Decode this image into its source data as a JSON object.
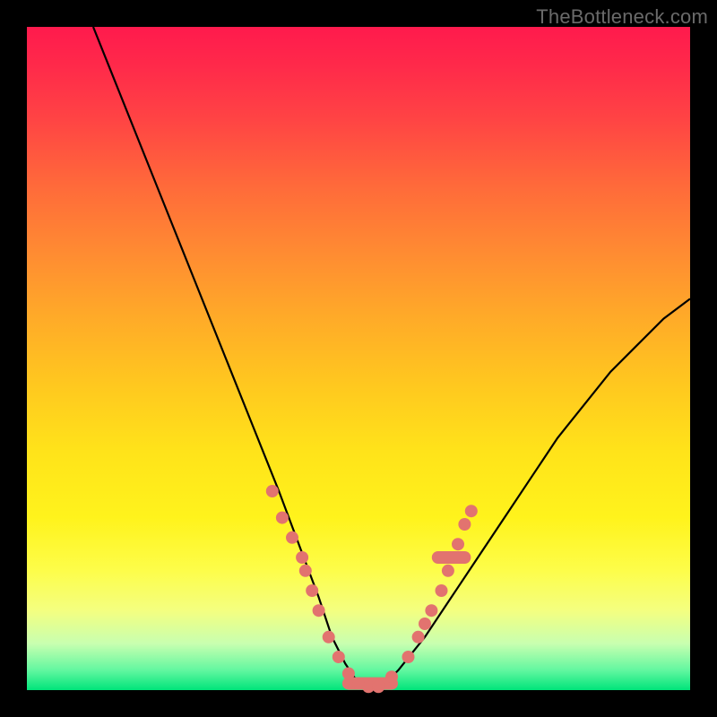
{
  "watermark": "TheBottleneck.com",
  "colors": {
    "frame": "#000000",
    "curve": "#000000",
    "marker": "#e2736f",
    "gradient_top": "#ff1a4d",
    "gradient_bottom": "#00e47a"
  },
  "chart_data": {
    "type": "line",
    "title": "",
    "xlabel": "",
    "ylabel": "",
    "xlim": [
      0,
      100
    ],
    "ylim": [
      0,
      100
    ],
    "series": [
      {
        "name": "bottleneck-curve",
        "x": [
          10,
          14,
          18,
          22,
          26,
          30,
          34,
          38,
          41,
          44,
          46,
          48,
          50,
          52,
          54,
          56,
          60,
          64,
          68,
          72,
          76,
          80,
          84,
          88,
          92,
          96,
          100
        ],
        "y": [
          100,
          90,
          80,
          70,
          60,
          50,
          40,
          30,
          22,
          14,
          8,
          4,
          1,
          0,
          1,
          3,
          8,
          14,
          20,
          26,
          32,
          38,
          43,
          48,
          52,
          56,
          59
        ]
      }
    ],
    "markers": [
      {
        "x": 37,
        "y": 30
      },
      {
        "x": 38.5,
        "y": 26
      },
      {
        "x": 40,
        "y": 23
      },
      {
        "x": 41.5,
        "y": 20
      },
      {
        "x": 42,
        "y": 18
      },
      {
        "x": 43,
        "y": 15
      },
      {
        "x": 44,
        "y": 12
      },
      {
        "x": 45.5,
        "y": 8
      },
      {
        "x": 47,
        "y": 5
      },
      {
        "x": 48.5,
        "y": 2.5
      },
      {
        "x": 50,
        "y": 1
      },
      {
        "x": 51.5,
        "y": 0.5
      },
      {
        "x": 53,
        "y": 0.5
      },
      {
        "x": 55,
        "y": 2
      },
      {
        "x": 57.5,
        "y": 5
      },
      {
        "x": 59,
        "y": 8
      },
      {
        "x": 60,
        "y": 10
      },
      {
        "x": 61,
        "y": 12
      },
      {
        "x": 62.5,
        "y": 15
      },
      {
        "x": 63.5,
        "y": 18
      },
      {
        "x": 65,
        "y": 22
      },
      {
        "x": 66,
        "y": 25
      },
      {
        "x": 67,
        "y": 27
      }
    ],
    "marker_bars": [
      {
        "x0": 48.5,
        "x1": 55,
        "y": 1
      },
      {
        "x0": 62,
        "x1": 66,
        "y": 20
      }
    ]
  }
}
